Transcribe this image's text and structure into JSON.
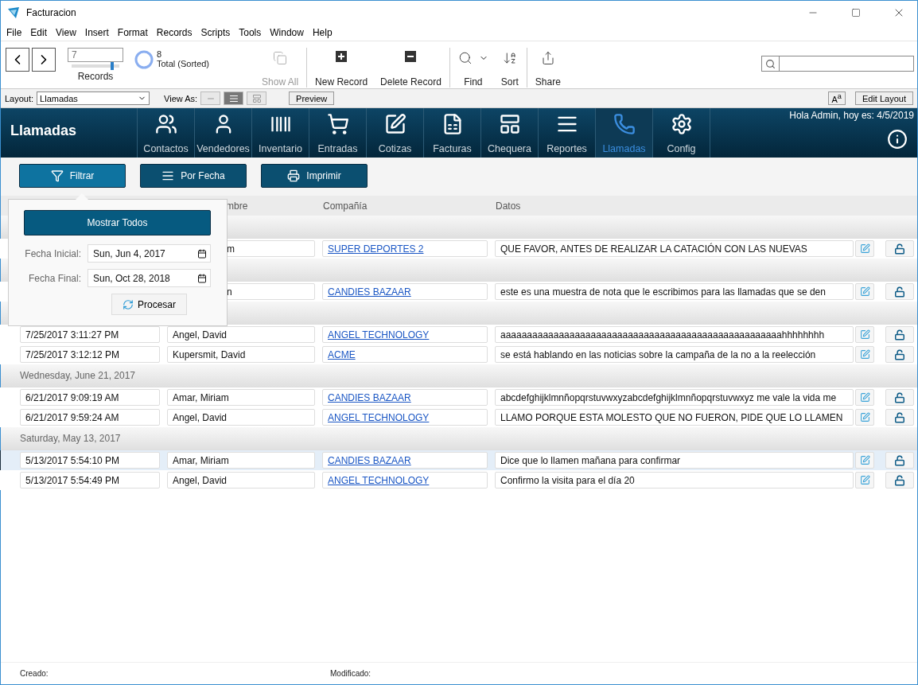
{
  "window": {
    "title": "Facturacion"
  },
  "menu": [
    "File",
    "Edit",
    "View",
    "Insert",
    "Format",
    "Records",
    "Scripts",
    "Tools",
    "Window",
    "Help"
  ],
  "toolbar": {
    "record_field": {
      "value": "7"
    },
    "record_slider": {
      "level": 0.85
    },
    "records_label": "Records",
    "found_count": "8",
    "total_label": "Total (Sorted)",
    "buttons": [
      {
        "label": "Show All",
        "kind": "show_all",
        "disabled": true
      },
      {
        "label": "New Record",
        "kind": "new",
        "disabled": false
      },
      {
        "label": "Delete Record",
        "kind": "delete",
        "disabled": false
      },
      {
        "label": "Find",
        "kind": "find",
        "disabled": false
      },
      {
        "label": "Sort",
        "kind": "sort",
        "disabled": false
      },
      {
        "label": "Share",
        "kind": "share",
        "disabled": false
      }
    ]
  },
  "layout_bar": {
    "layout_label": "Layout:",
    "layout_value": "Llamadas",
    "view_as_label": "View As:",
    "view_modes": [
      {
        "kind": "form",
        "selected": false
      },
      {
        "kind": "list",
        "selected": true
      },
      {
        "kind": "table",
        "selected": false
      }
    ],
    "preview": "Preview",
    "font_button": "A$^{a}$",
    "edit_layout": "Edit Layout"
  },
  "header": {
    "title": "Llamadas",
    "greeting": "Hola Admin, hoy es: 4/5/2019",
    "tabs": [
      {
        "label": "Contactos",
        "selected": false
      },
      {
        "label": "Vendedores",
        "selected": false
      },
      {
        "label": "Inventario",
        "selected": false
      },
      {
        "label": "Entradas",
        "selected": false
      },
      {
        "label": "Cotizas",
        "selected": false
      },
      {
        "label": "Facturas",
        "selected": false
      },
      {
        "label": "Chequera",
        "selected": false
      },
      {
        "label": "Reportes",
        "selected": false
      },
      {
        "label": "Llamadas",
        "selected": true
      },
      {
        "label": "Config",
        "selected": false
      }
    ]
  },
  "actions": [
    {
      "label": "Filtrar",
      "selected": true
    },
    {
      "label": "Por Fecha",
      "selected": false
    },
    {
      "label": "Imprimir",
      "selected": false
    }
  ],
  "columns": [
    {
      "label": "mbre",
      "kind": "covered"
    },
    {
      "label": "Compañía",
      "kind": "full"
    },
    {
      "label": "Datos",
      "kind": "full"
    }
  ],
  "groups": [
    {
      "rows": [
        {
          "kind": "covered",
          "selected": false,
          "name": "m",
          "company": "SUPER DEPORTES 2",
          "notes": "QUE FAVOR, ANTES DE REALIZAR LA CATACIÓN CON LAS NUEVAS"
        }
      ]
    },
    {
      "rows": [
        {
          "kind": "covered",
          "selected": false,
          "name": "n",
          "company": "CANDIES BAZAAR",
          "notes": "este es una muestra de nota que le escribimos para las llamadas que se den"
        }
      ]
    },
    {
      "rows": [
        {
          "kind": "full",
          "selected": false,
          "date": "7/25/2017 3:11:27 PM",
          "name": "Angel, David",
          "company": "ANGEL TECHNOLOGY",
          "notes": "aaaaaaaaaaaaaaaaaaaaaaaaaaaaaaaaaaaaaaaaaaaaaaaaaaaaahhhhhhhh"
        },
        {
          "kind": "full",
          "selected": false,
          "date": "7/25/2017 3:12:12 PM",
          "name": "Kupersmit, David",
          "company": "ACME",
          "notes": "se está hablando en las noticias sobre la campaña de la no a la reelección"
        }
      ]
    },
    {
      "header": "Wednesday, June 21, 2017",
      "rows": [
        {
          "kind": "full",
          "selected": false,
          "date": "6/21/2017 9:09:19 AM",
          "name": "Amar, Miriam",
          "company": "CANDIES BAZAAR",
          "notes": "abcdefghijklmnñopqrstuvwxyzabcdefghijklmnñopqrstuvwxyz me vale la vida me"
        },
        {
          "kind": "full",
          "selected": false,
          "date": "6/21/2017 9:59:24 AM",
          "name": "Angel, David",
          "company": "ANGEL TECHNOLOGY",
          "notes": "LLAMO PORQUE ESTA MOLESTO QUE NO FUERON, PIDE QUE LO LLAMEN"
        }
      ]
    },
    {
      "header": "Saturday, May 13, 2017",
      "rows": [
        {
          "kind": "full",
          "selected": true,
          "date": "5/13/2017 5:54:10 PM",
          "name": "Amar, Miriam",
          "company": "CANDIES BAZAAR",
          "notes": "Dice que lo llamen mañana para confirmar"
        },
        {
          "kind": "full",
          "selected": false,
          "date": "5/13/2017 5:54:49 PM",
          "name": "Angel, David",
          "company": "ANGEL TECHNOLOGY",
          "notes": "Confirmo la visita para el día 20"
        }
      ]
    }
  ],
  "popover": {
    "show_all": "Mostrar Todos",
    "start_label": "Fecha Inicial:",
    "start_value": "Sun, Jun 4, 2017",
    "end_label": "Fecha Final:",
    "end_value": "Sun, Oct 28, 2018",
    "process": "Procesar"
  },
  "footer": {
    "created": "Creado:",
    "modified": "Modificado:"
  }
}
